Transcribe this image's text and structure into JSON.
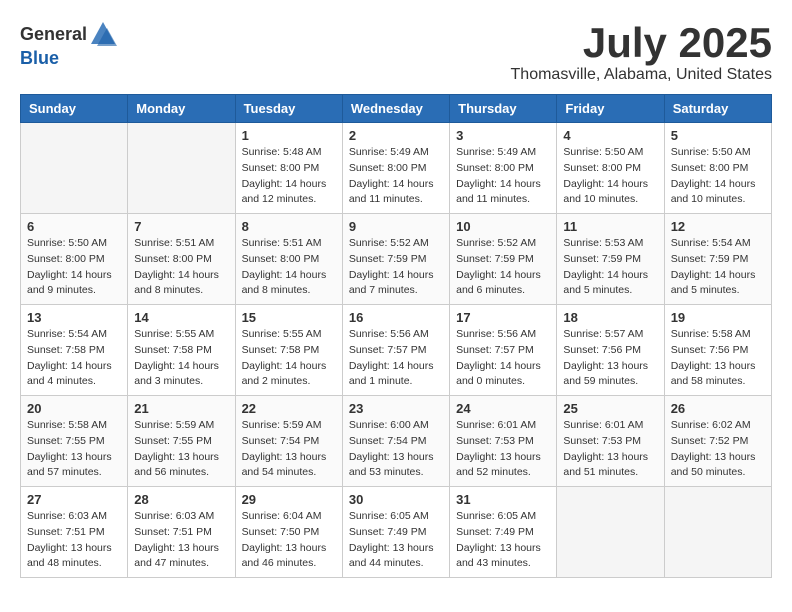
{
  "header": {
    "logo_general": "General",
    "logo_blue": "Blue",
    "title": "July 2025",
    "subtitle": "Thomasville, Alabama, United States"
  },
  "calendar": {
    "weekdays": [
      "Sunday",
      "Monday",
      "Tuesday",
      "Wednesday",
      "Thursday",
      "Friday",
      "Saturday"
    ],
    "weeks": [
      [
        {
          "day": "",
          "info": ""
        },
        {
          "day": "",
          "info": ""
        },
        {
          "day": "1",
          "info": "Sunrise: 5:48 AM\nSunset: 8:00 PM\nDaylight: 14 hours\nand 12 minutes."
        },
        {
          "day": "2",
          "info": "Sunrise: 5:49 AM\nSunset: 8:00 PM\nDaylight: 14 hours\nand 11 minutes."
        },
        {
          "day": "3",
          "info": "Sunrise: 5:49 AM\nSunset: 8:00 PM\nDaylight: 14 hours\nand 11 minutes."
        },
        {
          "day": "4",
          "info": "Sunrise: 5:50 AM\nSunset: 8:00 PM\nDaylight: 14 hours\nand 10 minutes."
        },
        {
          "day": "5",
          "info": "Sunrise: 5:50 AM\nSunset: 8:00 PM\nDaylight: 14 hours\nand 10 minutes."
        }
      ],
      [
        {
          "day": "6",
          "info": "Sunrise: 5:50 AM\nSunset: 8:00 PM\nDaylight: 14 hours\nand 9 minutes."
        },
        {
          "day": "7",
          "info": "Sunrise: 5:51 AM\nSunset: 8:00 PM\nDaylight: 14 hours\nand 8 minutes."
        },
        {
          "day": "8",
          "info": "Sunrise: 5:51 AM\nSunset: 8:00 PM\nDaylight: 14 hours\nand 8 minutes."
        },
        {
          "day": "9",
          "info": "Sunrise: 5:52 AM\nSunset: 7:59 PM\nDaylight: 14 hours\nand 7 minutes."
        },
        {
          "day": "10",
          "info": "Sunrise: 5:52 AM\nSunset: 7:59 PM\nDaylight: 14 hours\nand 6 minutes."
        },
        {
          "day": "11",
          "info": "Sunrise: 5:53 AM\nSunset: 7:59 PM\nDaylight: 14 hours\nand 5 minutes."
        },
        {
          "day": "12",
          "info": "Sunrise: 5:54 AM\nSunset: 7:59 PM\nDaylight: 14 hours\nand 5 minutes."
        }
      ],
      [
        {
          "day": "13",
          "info": "Sunrise: 5:54 AM\nSunset: 7:58 PM\nDaylight: 14 hours\nand 4 minutes."
        },
        {
          "day": "14",
          "info": "Sunrise: 5:55 AM\nSunset: 7:58 PM\nDaylight: 14 hours\nand 3 minutes."
        },
        {
          "day": "15",
          "info": "Sunrise: 5:55 AM\nSunset: 7:58 PM\nDaylight: 14 hours\nand 2 minutes."
        },
        {
          "day": "16",
          "info": "Sunrise: 5:56 AM\nSunset: 7:57 PM\nDaylight: 14 hours\nand 1 minute."
        },
        {
          "day": "17",
          "info": "Sunrise: 5:56 AM\nSunset: 7:57 PM\nDaylight: 14 hours\nand 0 minutes."
        },
        {
          "day": "18",
          "info": "Sunrise: 5:57 AM\nSunset: 7:56 PM\nDaylight: 13 hours\nand 59 minutes."
        },
        {
          "day": "19",
          "info": "Sunrise: 5:58 AM\nSunset: 7:56 PM\nDaylight: 13 hours\nand 58 minutes."
        }
      ],
      [
        {
          "day": "20",
          "info": "Sunrise: 5:58 AM\nSunset: 7:55 PM\nDaylight: 13 hours\nand 57 minutes."
        },
        {
          "day": "21",
          "info": "Sunrise: 5:59 AM\nSunset: 7:55 PM\nDaylight: 13 hours\nand 56 minutes."
        },
        {
          "day": "22",
          "info": "Sunrise: 5:59 AM\nSunset: 7:54 PM\nDaylight: 13 hours\nand 54 minutes."
        },
        {
          "day": "23",
          "info": "Sunrise: 6:00 AM\nSunset: 7:54 PM\nDaylight: 13 hours\nand 53 minutes."
        },
        {
          "day": "24",
          "info": "Sunrise: 6:01 AM\nSunset: 7:53 PM\nDaylight: 13 hours\nand 52 minutes."
        },
        {
          "day": "25",
          "info": "Sunrise: 6:01 AM\nSunset: 7:53 PM\nDaylight: 13 hours\nand 51 minutes."
        },
        {
          "day": "26",
          "info": "Sunrise: 6:02 AM\nSunset: 7:52 PM\nDaylight: 13 hours\nand 50 minutes."
        }
      ],
      [
        {
          "day": "27",
          "info": "Sunrise: 6:03 AM\nSunset: 7:51 PM\nDaylight: 13 hours\nand 48 minutes."
        },
        {
          "day": "28",
          "info": "Sunrise: 6:03 AM\nSunset: 7:51 PM\nDaylight: 13 hours\nand 47 minutes."
        },
        {
          "day": "29",
          "info": "Sunrise: 6:04 AM\nSunset: 7:50 PM\nDaylight: 13 hours\nand 46 minutes."
        },
        {
          "day": "30",
          "info": "Sunrise: 6:05 AM\nSunset: 7:49 PM\nDaylight: 13 hours\nand 44 minutes."
        },
        {
          "day": "31",
          "info": "Sunrise: 6:05 AM\nSunset: 7:49 PM\nDaylight: 13 hours\nand 43 minutes."
        },
        {
          "day": "",
          "info": ""
        },
        {
          "day": "",
          "info": ""
        }
      ]
    ]
  }
}
